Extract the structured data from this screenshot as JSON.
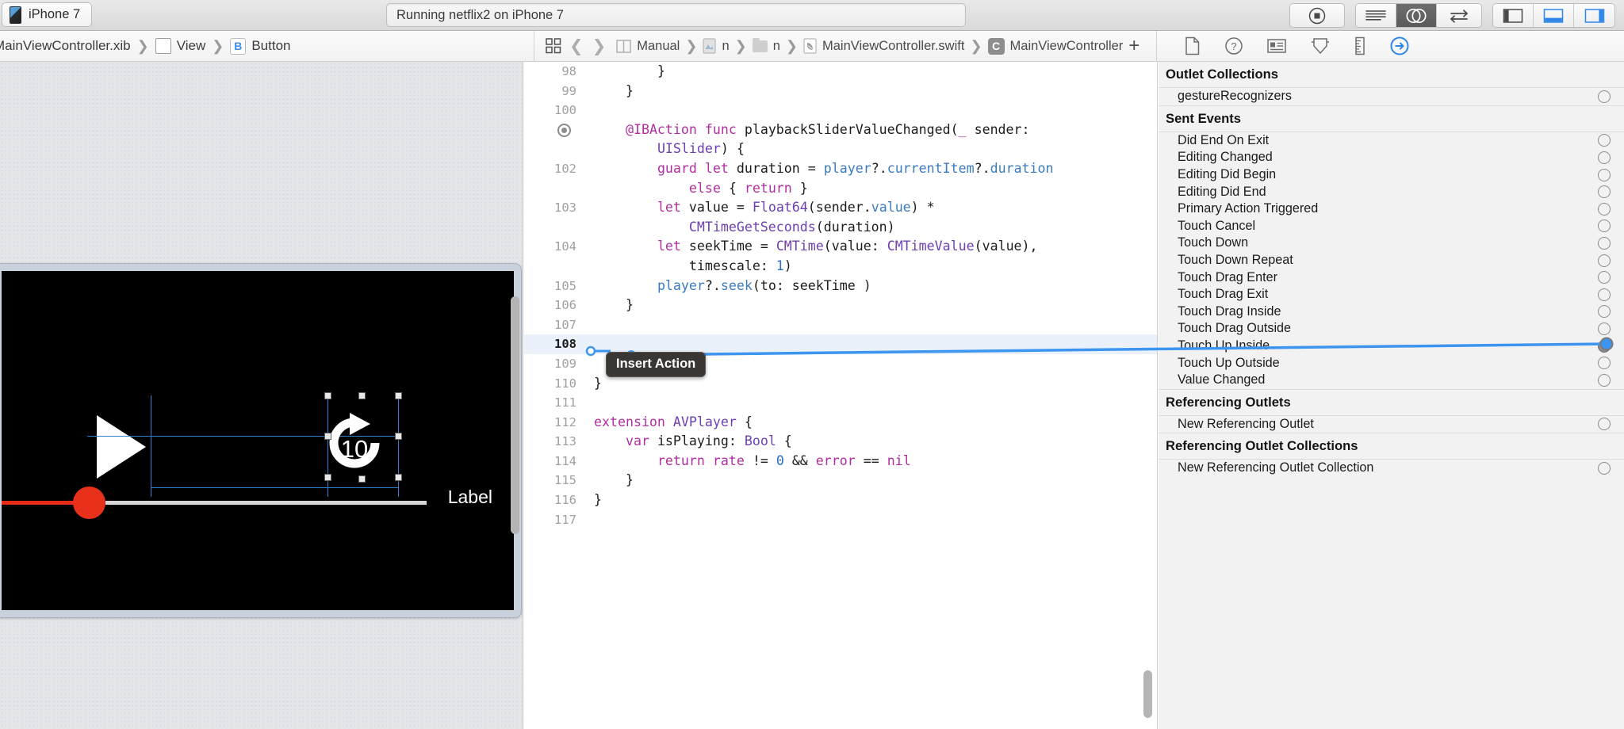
{
  "toolbar": {
    "scheme_label": "iPhone 7",
    "scheme_icon": "iphone-device-icon",
    "status_text": "Running netflix2 on iPhone 7",
    "stop_button_icon": "stop-button-icon",
    "standard_editor_icon": "standard-editor-icon",
    "assistant_editor_icon": "assistant-editor-icon",
    "version_editor_icon": "version-editor-icon",
    "navigator_toggle_icon": "hide-navigator-icon",
    "debug_toggle_icon": "hide-debug-area-icon",
    "utilities_toggle_icon": "hide-utilities-icon"
  },
  "ib_jumpbar": {
    "crumbs": [
      {
        "label": "MainViewController.xib",
        "icon": ""
      },
      {
        "label": "View",
        "icon": "view-box-icon"
      },
      {
        "label": "Button",
        "icon": "button-b-badge-icon"
      }
    ]
  },
  "editor_jumpbar": {
    "related_items_icon": "related-items-icon",
    "back_icon": "navigate-back-icon",
    "forward_icon": "navigate-forward-icon",
    "crumbs": [
      {
        "label": "Manual",
        "icon": "assistant-manual-icon"
      },
      {
        "label": "n",
        "icon": "project-file-icon"
      },
      {
        "label": "n",
        "icon": "folder-icon"
      },
      {
        "label": "MainViewController.swift",
        "icon": "swift-file-icon"
      },
      {
        "label": "MainViewController",
        "icon": "class-c-badge-icon"
      }
    ],
    "add_label": "+",
    "close_label": "✕"
  },
  "inspector_jumpbar": {
    "tabs": [
      {
        "name": "file-inspector-icon",
        "active": false
      },
      {
        "name": "quick-help-inspector-icon",
        "active": false
      },
      {
        "name": "identity-inspector-icon",
        "active": false
      },
      {
        "name": "attributes-inspector-icon",
        "active": false
      },
      {
        "name": "size-inspector-icon",
        "active": false
      },
      {
        "name": "connections-inspector-icon",
        "active": true
      }
    ]
  },
  "canvas": {
    "play_button_icon": "play-triangle-icon",
    "forward_ten_icon": "forward-10-seconds-icon",
    "forward_ten_value": "10",
    "label_text": "Label",
    "slider_name": "playback-slider",
    "selection": "forward-10-button-selected"
  },
  "code": {
    "language": "swift",
    "lines": [
      {
        "num": "98",
        "indent": 4,
        "tokens": [
          {
            "t": "}",
            "c": "pl"
          }
        ]
      },
      {
        "num": "99",
        "indent": 2,
        "tokens": [
          {
            "t": "}",
            "c": "pl"
          }
        ]
      },
      {
        "num": "100",
        "indent": 0,
        "tokens": []
      },
      {
        "num": "",
        "breakpoint": true,
        "indent": 2,
        "tokens": [
          {
            "t": "@IBAction",
            "c": "k"
          },
          {
            "t": " ",
            "c": "pl"
          },
          {
            "t": "func",
            "c": "k"
          },
          {
            "t": " playbackSliderValueChanged(",
            "c": "pl"
          },
          {
            "t": "_",
            "c": "k"
          },
          {
            "t": " sender:",
            "c": "pl"
          }
        ]
      },
      {
        "num": "",
        "indent": 4,
        "cont": true,
        "tokens": [
          {
            "t": "UISlider",
            "c": "ty"
          },
          {
            "t": ") {",
            "c": "pl"
          }
        ]
      },
      {
        "num": "102",
        "indent": 4,
        "tokens": [
          {
            "t": "guard",
            "c": "k"
          },
          {
            "t": " ",
            "c": "pl"
          },
          {
            "t": "let",
            "c": "k"
          },
          {
            "t": " duration = ",
            "c": "pl"
          },
          {
            "t": "player",
            "c": "id"
          },
          {
            "t": "?.",
            "c": "pl"
          },
          {
            "t": "currentItem",
            "c": "id"
          },
          {
            "t": "?.",
            "c": "pl"
          },
          {
            "t": "duration",
            "c": "id"
          }
        ]
      },
      {
        "num": "",
        "indent": 6,
        "cont": true,
        "tokens": [
          {
            "t": "else",
            "c": "k"
          },
          {
            "t": " { ",
            "c": "pl"
          },
          {
            "t": "return",
            "c": "k"
          },
          {
            "t": " }",
            "c": "pl"
          }
        ]
      },
      {
        "num": "103",
        "indent": 4,
        "tokens": [
          {
            "t": "let",
            "c": "k"
          },
          {
            "t": " value = ",
            "c": "pl"
          },
          {
            "t": "Float64",
            "c": "ty"
          },
          {
            "t": "(sender.",
            "c": "pl"
          },
          {
            "t": "value",
            "c": "id"
          },
          {
            "t": ") *",
            "c": "pl"
          }
        ]
      },
      {
        "num": "",
        "indent": 6,
        "cont": true,
        "tokens": [
          {
            "t": "CMTimeGetSeconds",
            "c": "ty"
          },
          {
            "t": "(duration)",
            "c": "pl"
          }
        ]
      },
      {
        "num": "104",
        "indent": 4,
        "tokens": [
          {
            "t": "let",
            "c": "k"
          },
          {
            "t": " seekTime = ",
            "c": "pl"
          },
          {
            "t": "CMTime",
            "c": "ty"
          },
          {
            "t": "(value: ",
            "c": "pl"
          },
          {
            "t": "CMTimeValue",
            "c": "ty"
          },
          {
            "t": "(value),",
            "c": "pl"
          }
        ]
      },
      {
        "num": "",
        "indent": 6,
        "cont": true,
        "tokens": [
          {
            "t": "timescale: ",
            "c": "pl"
          },
          {
            "t": "1",
            "c": "num"
          },
          {
            "t": ")",
            "c": "pl"
          }
        ]
      },
      {
        "num": "105",
        "indent": 4,
        "tokens": [
          {
            "t": "player",
            "c": "id"
          },
          {
            "t": "?.",
            "c": "pl"
          },
          {
            "t": "seek",
            "c": "id"
          },
          {
            "t": "(to: seekTime )",
            "c": "pl"
          }
        ]
      },
      {
        "num": "106",
        "indent": 2,
        "tokens": [
          {
            "t": "}",
            "c": "pl"
          }
        ]
      },
      {
        "num": "107",
        "indent": 0,
        "tokens": []
      },
      {
        "num": "108",
        "indent": 0,
        "highlight": true,
        "tokens": []
      },
      {
        "num": "109",
        "indent": 0,
        "tokens": []
      },
      {
        "num": "110",
        "indent": 0,
        "tokens": [
          {
            "t": "}",
            "c": "pl"
          }
        ]
      },
      {
        "num": "111",
        "indent": 0,
        "tokens": []
      },
      {
        "num": "112",
        "indent": 0,
        "tokens": [
          {
            "t": "extension",
            "c": "k"
          },
          {
            "t": " ",
            "c": "pl"
          },
          {
            "t": "AVPlayer",
            "c": "ty"
          },
          {
            "t": " {",
            "c": "pl"
          }
        ]
      },
      {
        "num": "113",
        "indent": 2,
        "tokens": [
          {
            "t": "var",
            "c": "k"
          },
          {
            "t": " isPlaying: ",
            "c": "pl"
          },
          {
            "t": "Bool",
            "c": "ty"
          },
          {
            "t": " {",
            "c": "pl"
          }
        ]
      },
      {
        "num": "114",
        "indent": 4,
        "tokens": [
          {
            "t": "return",
            "c": "k"
          },
          {
            "t": " ",
            "c": "pl"
          },
          {
            "t": "rate",
            "c": "k"
          },
          {
            "t": " != ",
            "c": "pl"
          },
          {
            "t": "0",
            "c": "num"
          },
          {
            "t": " && ",
            "c": "pl"
          },
          {
            "t": "error",
            "c": "k"
          },
          {
            "t": " == ",
            "c": "pl"
          },
          {
            "t": "nil",
            "c": "k"
          }
        ]
      },
      {
        "num": "115",
        "indent": 2,
        "tokens": [
          {
            "t": "}",
            "c": "pl"
          }
        ]
      },
      {
        "num": "116",
        "indent": 0,
        "tokens": [
          {
            "t": "}",
            "c": "pl"
          }
        ]
      },
      {
        "num": "117",
        "indent": 0,
        "tokens": []
      }
    ]
  },
  "connection": {
    "tooltip_label": "Insert Action",
    "line_color": "#3d95ef",
    "from_event": "Touch Up Inside"
  },
  "inspector": {
    "sections": [
      {
        "title": "Outlet Collections",
        "rows": [
          {
            "label": "gestureRecognizers",
            "connected": false
          }
        ]
      },
      {
        "title": "Sent Events",
        "rows": [
          {
            "label": "Did End On Exit",
            "connected": false
          },
          {
            "label": "Editing Changed",
            "connected": false
          },
          {
            "label": "Editing Did Begin",
            "connected": false
          },
          {
            "label": "Editing Did End",
            "connected": false
          },
          {
            "label": "Primary Action Triggered",
            "connected": false
          },
          {
            "label": "Touch Cancel",
            "connected": false
          },
          {
            "label": "Touch Down",
            "connected": false
          },
          {
            "label": "Touch Down Repeat",
            "connected": false
          },
          {
            "label": "Touch Drag Enter",
            "connected": false
          },
          {
            "label": "Touch Drag Exit",
            "connected": false
          },
          {
            "label": "Touch Drag Inside",
            "connected": false
          },
          {
            "label": "Touch Drag Outside",
            "connected": false
          },
          {
            "label": "Touch Up Inside",
            "connected": true
          },
          {
            "label": "Touch Up Outside",
            "connected": false
          },
          {
            "label": "Value Changed",
            "connected": false
          }
        ]
      },
      {
        "title": "Referencing Outlets",
        "rows": [
          {
            "label": "New Referencing Outlet",
            "connected": false
          }
        ]
      },
      {
        "title": "Referencing Outlet Collections",
        "rows": [
          {
            "label": "New Referencing Outlet Collection",
            "connected": false
          }
        ]
      }
    ]
  },
  "colors": {
    "accent_blue": "#3d95ef",
    "keyword_purple": "#b02ea0",
    "type_purple": "#6e3fb0",
    "id_blue": "#3b7bbf",
    "slider_red": "#e8301b",
    "inspector_bg": "#f2f2f2"
  }
}
